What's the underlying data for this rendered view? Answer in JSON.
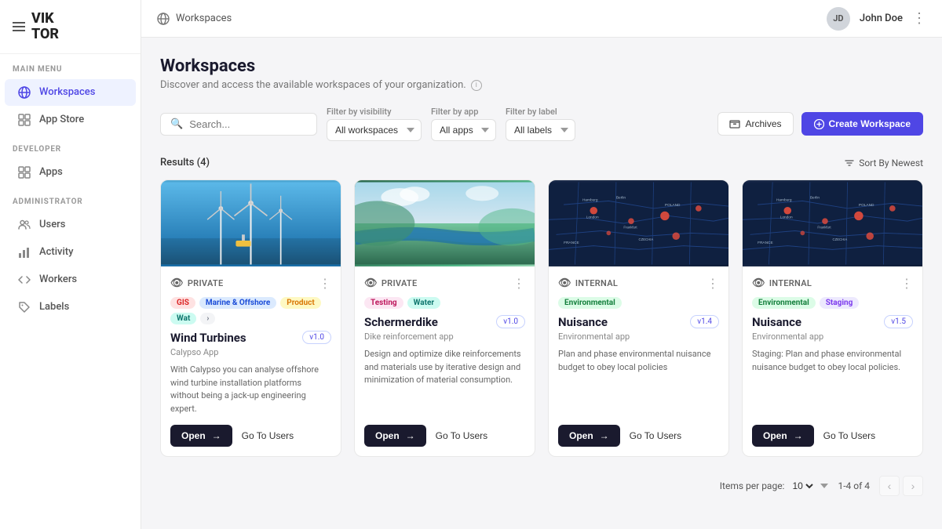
{
  "sidebar": {
    "logo_line1": "VIK",
    "logo_line2": "TOR",
    "sections": [
      {
        "label": "MAIN MENU",
        "items": [
          {
            "id": "workspaces",
            "label": "Workspaces",
            "active": true,
            "icon": "globe"
          },
          {
            "id": "app-store",
            "label": "App Store",
            "active": false,
            "icon": "grid"
          }
        ]
      },
      {
        "label": "DEVELOPER",
        "items": [
          {
            "id": "apps",
            "label": "Apps",
            "active": false,
            "icon": "grid"
          }
        ]
      },
      {
        "label": "ADMINISTRATOR",
        "items": [
          {
            "id": "users",
            "label": "Users",
            "active": false,
            "icon": "users"
          },
          {
            "id": "activity",
            "label": "Activity",
            "active": false,
            "icon": "bar-chart"
          },
          {
            "id": "workers",
            "label": "Workers",
            "active": false,
            "icon": "code"
          },
          {
            "id": "labels",
            "label": "Labels",
            "active": false,
            "icon": "tag"
          }
        ]
      }
    ]
  },
  "topbar": {
    "breadcrumb": "Workspaces",
    "user_initials": "JD",
    "user_name": "John Doe"
  },
  "page": {
    "title": "Workspaces",
    "subtitle": "Discover and access the available workspaces of your organization.",
    "search_placeholder": "Search...",
    "filter_visibility_label": "Filter by visibility",
    "filter_visibility_value": "All workspaces",
    "filter_app_label": "Filter by app",
    "filter_app_value": "All apps",
    "filter_label_label": "Filter by label",
    "filter_label_value": "All labels",
    "archives_btn": "Archives",
    "create_btn": "Create Workspace",
    "results_label": "Results (4)",
    "sort_label": "Sort By Newest",
    "items_per_page_label": "Items per page:",
    "items_per_page_value": "10",
    "pagination_info": "1-4 of 4"
  },
  "cards": [
    {
      "id": "wind-turbines",
      "image_type": "wind",
      "visibility": "PRIVATE",
      "title": "Wind Turbines",
      "subtitle": "Calypso App",
      "version": "v1.0",
      "tags": [
        {
          "label": "GIS",
          "class": "tag-gis"
        },
        {
          "label": "Marine & Offshore",
          "class": "tag-marine"
        },
        {
          "label": "Product",
          "class": "tag-product"
        },
        {
          "label": "Wat",
          "class": "tag-water"
        }
      ],
      "description": "With Calypso you can analyse offshore wind turbine installation platforms without being a jack-up engineering expert.",
      "open_btn": "Open",
      "goto_btn": "Go To Users"
    },
    {
      "id": "schermerdike",
      "image_type": "river",
      "visibility": "PRIVATE",
      "title": "Schermerdike",
      "subtitle": "Dike reinforcement app",
      "version": "v1.0",
      "tags": [
        {
          "label": "Testing",
          "class": "tag-testing"
        },
        {
          "label": "Water",
          "class": "tag-water"
        }
      ],
      "description": "Design and optimize dike reinforcements and materials use by iterative design and minimization of material consumption.",
      "open_btn": "Open",
      "goto_btn": "Go To Users"
    },
    {
      "id": "nuisance-1",
      "image_type": "map",
      "visibility": "INTERNAL",
      "title": "Nuisance",
      "subtitle": "Environmental app",
      "version": "v1.4",
      "tags": [
        {
          "label": "Environmental",
          "class": "tag-environmental"
        }
      ],
      "description": "Plan and phase environmental nuisance budget to obey local policies",
      "open_btn": "Open",
      "goto_btn": "Go To Users"
    },
    {
      "id": "nuisance-2",
      "image_type": "map",
      "visibility": "INTERNAL",
      "title": "Nuisance",
      "subtitle": "Environmental app",
      "version": "v1.5",
      "tags": [
        {
          "label": "Environmental",
          "class": "tag-environmental"
        },
        {
          "label": "Staging",
          "class": "tag-staging"
        }
      ],
      "description": "Staging: Plan and phase environmental nuisance budget to obey local policies.",
      "open_btn": "Open",
      "goto_btn": "Go To Users"
    }
  ]
}
